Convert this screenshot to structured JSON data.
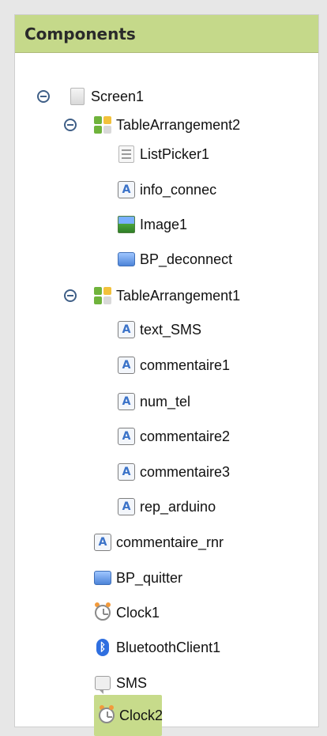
{
  "panel": {
    "title": "Components"
  },
  "tree": {
    "nodes": [
      {
        "label": "Screen1",
        "icon": "screen-icon",
        "level": 0,
        "toggle": true
      },
      {
        "label": "TableArrangement2",
        "icon": "table-arrangement-icon",
        "level": 1,
        "toggle": true
      },
      {
        "label": "ListPicker1",
        "icon": "listpicker-icon",
        "level": 2
      },
      {
        "label": "info_connec",
        "icon": "label-icon",
        "level": 2
      },
      {
        "label": "Image1",
        "icon": "image-icon",
        "level": 2
      },
      {
        "label": "BP_deconnect",
        "icon": "button-icon",
        "level": 2
      },
      {
        "label": "TableArrangement1",
        "icon": "table-arrangement-icon",
        "level": 1,
        "toggle": true
      },
      {
        "label": "text_SMS",
        "icon": "label-icon",
        "level": 2
      },
      {
        "label": "commentaire1",
        "icon": "label-icon",
        "level": 2
      },
      {
        "label": "num_tel",
        "icon": "label-icon",
        "level": 2
      },
      {
        "label": "commentaire2",
        "icon": "label-icon",
        "level": 2
      },
      {
        "label": "commentaire3",
        "icon": "label-icon",
        "level": 2
      },
      {
        "label": "rep_arduino",
        "icon": "label-icon",
        "level": 2
      },
      {
        "label": "commentaire_rnr",
        "icon": "label-icon",
        "level": 1
      },
      {
        "label": "BP_quitter",
        "icon": "button-icon",
        "level": 1
      },
      {
        "label": "Clock1",
        "icon": "clock-icon",
        "level": 1
      },
      {
        "label": "BluetoothClient1",
        "icon": "bluetooth-icon",
        "level": 1
      },
      {
        "label": "SMS",
        "icon": "sms-icon",
        "level": 1
      },
      {
        "label": "Clock2",
        "icon": "clock-icon",
        "level": 1,
        "selected": true
      }
    ]
  },
  "colors": {
    "header_bg": "#c5d98a",
    "selection_bg": "#c7db8b",
    "toggle_color": "#3f5f87"
  }
}
